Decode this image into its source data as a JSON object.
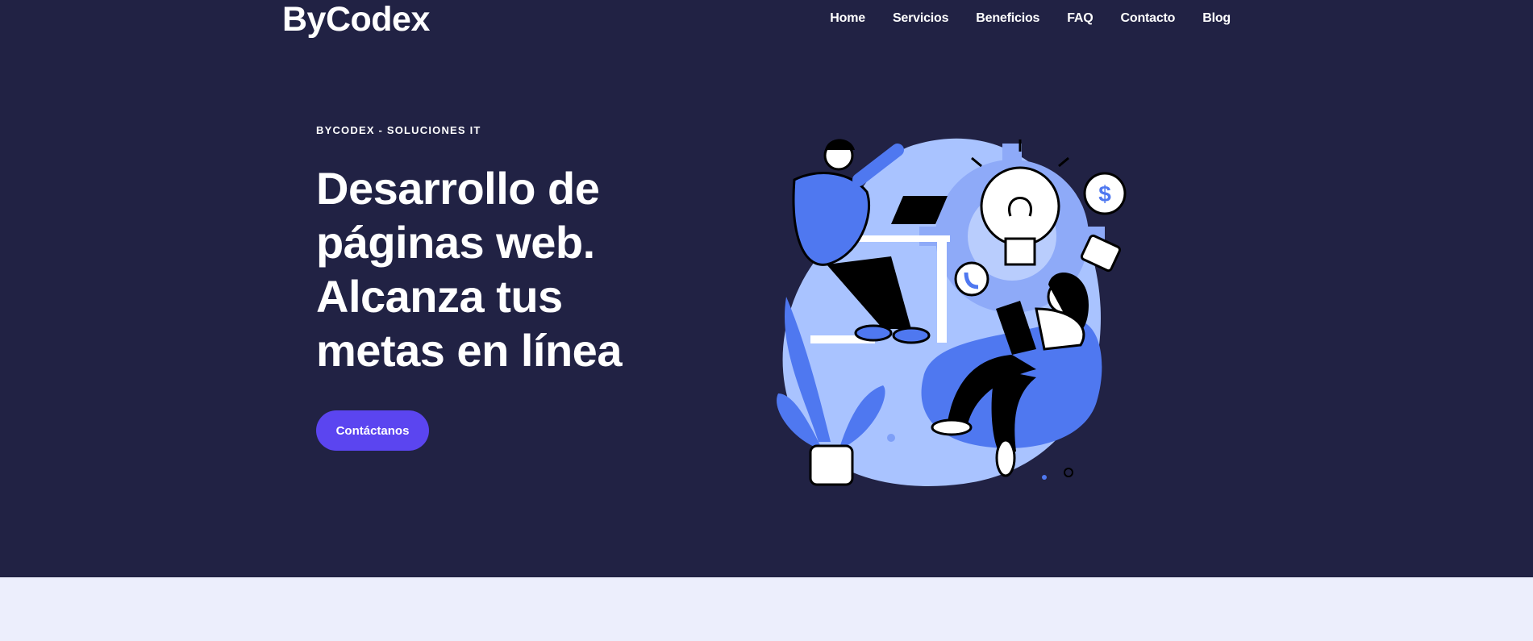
{
  "header": {
    "logo": "ByCodex",
    "nav": [
      "Home",
      "Servicios",
      "Beneficios",
      "FAQ",
      "Contacto",
      "Blog"
    ]
  },
  "hero": {
    "eyebrow": "BYCODEX - SOLUCIONES IT",
    "headline": "Desarrollo de páginas web. Alcanza tus metas en línea",
    "cta_label": "Contáctanos",
    "illustration_icon": "team-working-illustration"
  },
  "colors": {
    "hero_bg": "#212244",
    "accent": "#5b45f0",
    "illustration_blue": "#4f78f0",
    "illustration_light": "#a9c3ff",
    "section_bg": "#eceefc"
  }
}
